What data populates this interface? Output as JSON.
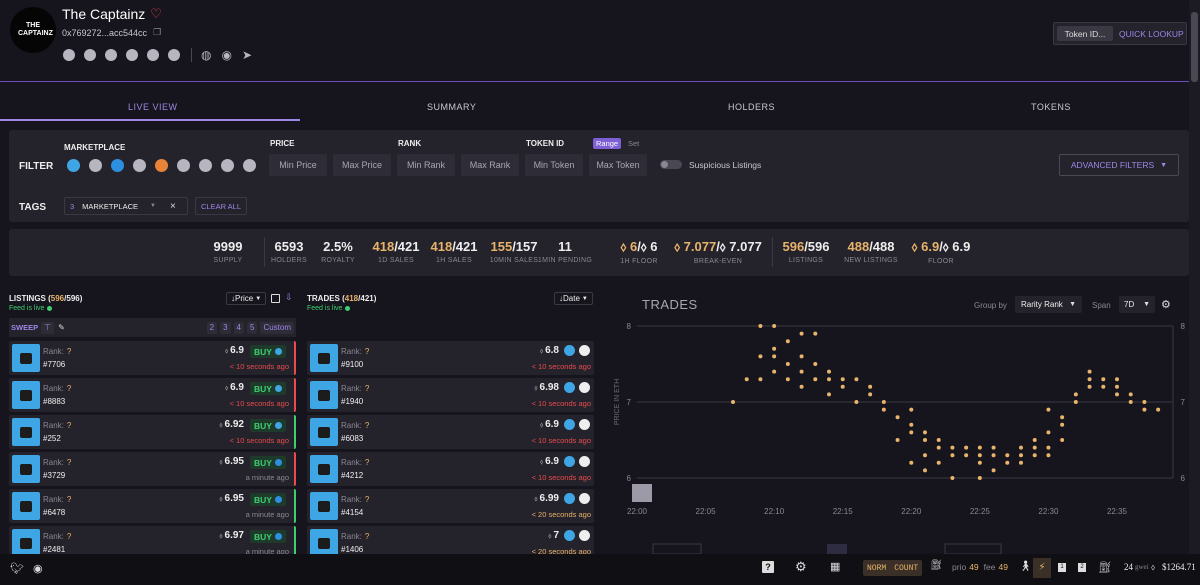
{
  "header": {
    "logo_text": "THE CAPTAINZ",
    "title": "The Captainz",
    "address": "0x769272...acc544cc",
    "marketplace_icons": [
      "opensea-icon",
      "looksrare-icon",
      "x2y2-icon",
      "gem-icon",
      "blur-icon",
      "nftnerds-icon"
    ],
    "social_icons": [
      "globe-icon",
      "discord-icon",
      "twitter-icon"
    ],
    "token_id_placeholder": "Token ID...",
    "quick_lookup_label": "QUICK LOOKUP"
  },
  "tabs": [
    "LIVE VIEW",
    "SUMMARY",
    "HOLDERS",
    "TOKENS"
  ],
  "filter": {
    "label": "FILTER",
    "marketplace_label": "MARKETPLACE",
    "price_label": "PRICE",
    "rank_label": "RANK",
    "token_id_label": "TOKEN ID",
    "range_label": "Range",
    "set_label": "Set",
    "min_price": "Min Price",
    "max_price": "Max Price",
    "min_rank": "Min Rank",
    "max_rank": "Max Rank",
    "min_token": "Min Token",
    "max_token": "Max Token",
    "suspicious_label": "Suspicious Listings",
    "advanced_label": "ADVANCED FILTERS",
    "tags_label": "TAGS",
    "tag_count": "3",
    "tag_name": "MARKETPLACE",
    "tag_clear": "×",
    "clear_all": "CLEAR ALL"
  },
  "stats": [
    {
      "value": "9999",
      "label": "SUPPLY"
    },
    {
      "value": "6593",
      "label": "HOLDERS"
    },
    {
      "value": "2.5%",
      "label": "ROYALTY"
    },
    {
      "value_a": "418",
      "value_b": "/421",
      "label": "1D SALES"
    },
    {
      "value_a": "418",
      "value_b": "/421",
      "label": "1H SALES"
    },
    {
      "value_a": "155",
      "value_b": "/157",
      "label": "10MIN SALES"
    },
    {
      "value": "11",
      "label": "1MIN PENDING"
    },
    {
      "value_a": "⬨ 6",
      "value_b": "/⬨ 6",
      "label": "1H FLOOR"
    },
    {
      "value_a": "⬨ 7.077",
      "value_b": "/⬨ 7.077",
      "label": "BREAK-EVEN"
    },
    {
      "value_a": "596",
      "value_b": "/596",
      "label": "LISTINGS"
    },
    {
      "value_a": "488",
      "value_b": "/488",
      "label": "NEW LISTINGS"
    },
    {
      "value_a": "⬨ 6.9",
      "value_b": "/⬨ 6.9",
      "label": "FLOOR"
    }
  ],
  "listings": {
    "title_pre": "LISTINGS (",
    "count_a": "596",
    "count_b": "/596)",
    "feed": "Feed is live",
    "sort_label": "Price",
    "sweep_label": "SWEEP",
    "sweep_options": [
      "2",
      "3",
      "4",
      "5",
      "Custom"
    ],
    "rank_label": "Rank:",
    "rank_value": "?",
    "buy_label": "BUY",
    "items": [
      {
        "id": "#7706",
        "price": "6.9",
        "time": "< 10 seconds ago",
        "time_color": "red"
      },
      {
        "id": "#8883",
        "price": "6.9",
        "time": "< 10 seconds ago",
        "time_color": "red"
      },
      {
        "id": "#252",
        "price": "6.92",
        "time": "< 10 seconds ago",
        "time_color": "red"
      },
      {
        "id": "#3729",
        "price": "6.95",
        "time": "a minute ago",
        "time_color": "grey"
      },
      {
        "id": "#6478",
        "price": "6.95",
        "time": "a minute ago",
        "time_color": "grey"
      },
      {
        "id": "#2481",
        "price": "6.97",
        "time": "a minute ago",
        "time_color": "grey"
      }
    ]
  },
  "trades": {
    "title_pre": "TRADES (",
    "count_a": "418",
    "count_b": "/421)",
    "feed": "Feed is live",
    "sort_label": "Date",
    "rank_label": "Rank:",
    "rank_value": "?",
    "items": [
      {
        "id": "#9100",
        "price": "6.8",
        "time": "< 10 seconds ago",
        "time_color": "red"
      },
      {
        "id": "#1940",
        "price": "6.98",
        "time": "< 10 seconds ago",
        "time_color": "red"
      },
      {
        "id": "#6083",
        "price": "6.9",
        "time": "< 10 seconds ago",
        "time_color": "red"
      },
      {
        "id": "#4212",
        "price": "6.9",
        "time": "< 10 seconds ago",
        "time_color": "red"
      },
      {
        "id": "#4154",
        "price": "6.99",
        "time": "< 20 seconds ago",
        "time_color": "gold"
      },
      {
        "id": "#1406",
        "price": "7",
        "time": "< 20 seconds ago",
        "time_color": "gold"
      }
    ]
  },
  "chart_panel": {
    "title": "TRADES",
    "group_by_label": "Group by",
    "group_by_value": "Rarity Rank",
    "span_label": "Span",
    "span_value": "7D"
  },
  "chart_data": {
    "type": "scatter",
    "title": "TRADES",
    "ylabel": "PRICE IN ETH",
    "xlabel": "",
    "ylim": [
      6,
      8
    ],
    "y_ticks": [
      "8",
      "7",
      "6"
    ],
    "x_ticks": [
      "22:00",
      "22:05",
      "22:10",
      "22:15",
      "22:20",
      "22:25",
      "22:30",
      "22:35"
    ],
    "series": [
      {
        "points": [
          [
            7.0,
            22.07
          ],
          [
            8.0,
            22.09
          ],
          [
            8.0,
            22.1
          ],
          [
            7.9,
            22.12
          ],
          [
            7.9,
            22.13
          ],
          [
            7.8,
            22.11
          ],
          [
            7.7,
            22.1
          ],
          [
            7.6,
            22.09
          ],
          [
            7.6,
            22.1
          ],
          [
            7.5,
            22.11
          ],
          [
            7.3,
            22.08
          ],
          [
            7.3,
            22.09
          ],
          [
            7.4,
            22.1
          ],
          [
            7.3,
            22.11
          ],
          [
            7.4,
            22.12
          ],
          [
            7.3,
            22.13
          ],
          [
            7.3,
            22.14
          ],
          [
            7.4,
            22.14
          ],
          [
            7.3,
            22.15
          ],
          [
            7.2,
            22.15
          ],
          [
            7.5,
            22.13
          ],
          [
            7.6,
            22.12
          ],
          [
            7.2,
            22.12
          ],
          [
            7.1,
            22.14
          ],
          [
            7.0,
            22.16
          ],
          [
            7.3,
            22.16
          ],
          [
            7.2,
            22.17
          ],
          [
            7.1,
            22.17
          ],
          [
            7.0,
            22.18
          ],
          [
            6.9,
            22.18
          ],
          [
            6.8,
            22.19
          ],
          [
            6.9,
            22.2
          ],
          [
            6.7,
            22.2
          ],
          [
            6.6,
            22.21
          ],
          [
            6.5,
            22.19
          ],
          [
            6.5,
            22.21
          ],
          [
            6.4,
            22.22
          ],
          [
            6.5,
            22.22
          ],
          [
            6.4,
            22.23
          ],
          [
            6.3,
            22.23
          ],
          [
            6.4,
            22.24
          ],
          [
            6.3,
            22.24
          ],
          [
            6.2,
            22.22
          ],
          [
            6.1,
            22.21
          ],
          [
            6.0,
            22.23
          ],
          [
            6.3,
            22.25
          ],
          [
            6.2,
            22.25
          ],
          [
            6.4,
            22.26
          ],
          [
            6.3,
            22.26
          ],
          [
            6.2,
            22.27
          ],
          [
            6.3,
            22.27
          ],
          [
            6.1,
            22.26
          ],
          [
            6.0,
            22.25
          ],
          [
            6.3,
            22.28
          ],
          [
            6.4,
            22.28
          ],
          [
            6.2,
            22.28
          ],
          [
            6.3,
            22.29
          ],
          [
            6.4,
            22.29
          ],
          [
            6.5,
            22.29
          ],
          [
            6.3,
            22.3
          ],
          [
            6.4,
            22.3
          ],
          [
            6.6,
            22.3
          ],
          [
            6.5,
            22.31
          ],
          [
            6.8,
            22.31
          ],
          [
            6.9,
            22.3
          ],
          [
            7.0,
            22.32
          ],
          [
            7.1,
            22.32
          ],
          [
            7.2,
            22.33
          ],
          [
            7.3,
            22.33
          ],
          [
            7.2,
            22.34
          ],
          [
            7.3,
            22.34
          ],
          [
            7.1,
            22.35
          ],
          [
            7.2,
            22.35
          ],
          [
            7.0,
            22.36
          ],
          [
            7.1,
            22.36
          ],
          [
            6.9,
            22.37
          ],
          [
            7.0,
            22.37
          ],
          [
            6.9,
            22.38
          ],
          [
            7.4,
            22.33
          ],
          [
            7.3,
            22.35
          ],
          [
            6.2,
            22.2
          ],
          [
            6.3,
            22.21
          ],
          [
            6.4,
            22.25
          ],
          [
            6.6,
            22.2
          ],
          [
            6.7,
            22.31
          ]
        ]
      }
    ]
  },
  "footer": {
    "norm_label": "NORM",
    "count_label": "COUNT",
    "prio_label": "prio",
    "prio_value": "49",
    "fee_label": "fee",
    "fee_value": "49",
    "gwei_value": "24",
    "gwei_label": "gwei",
    "eth_price": "$1264.71"
  },
  "colors": {
    "accent": "#9f87e8",
    "gold": "#e8b36a",
    "live": "#3ecf6f",
    "recent": "#e84c4c"
  }
}
